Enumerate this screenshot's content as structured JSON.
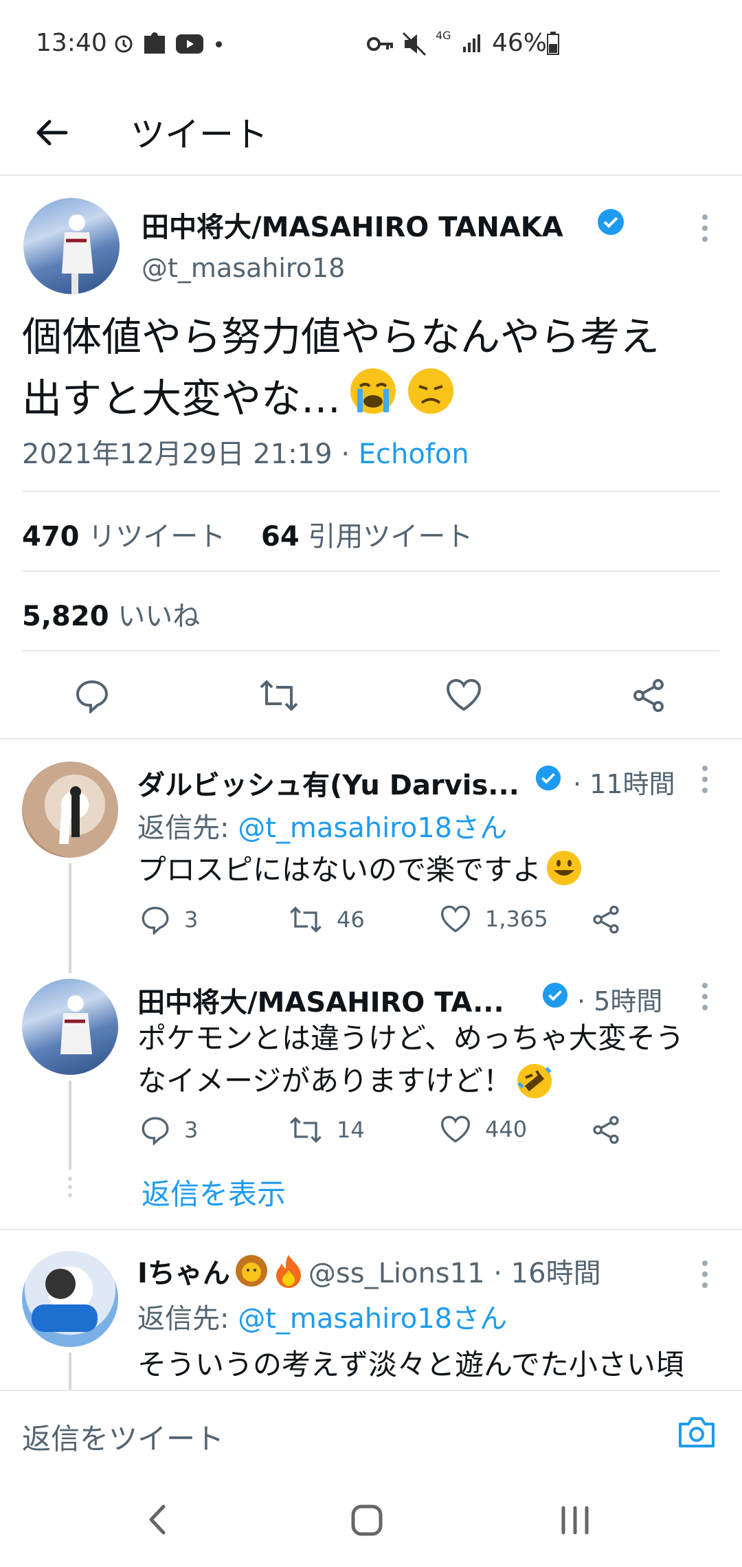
{
  "status_bar": {
    "time": "13:40",
    "battery": "46%",
    "network": "4G"
  },
  "header": {
    "title": "ツイート"
  },
  "main_tweet": {
    "display_name": "田中将大/MASAHIRO TANAKA",
    "handle": "@t_masahiro18",
    "text_line1": "個体値やら努力値やらなんやら考え",
    "text_line2": "出すと大変やな…",
    "timestamp": "2021年12月29日 21:19",
    "separator": "·",
    "client": "Echofon",
    "retweets": "470",
    "retweets_label": "リツイート",
    "quotes": "64",
    "quotes_label": "引用ツイート",
    "likes": "5,820",
    "likes_label": "いいね"
  },
  "replies": [
    {
      "display_name": "ダルビッシュ有(Yu Darvis...",
      "time": "· 11時間",
      "reply_to_label": "返信先:",
      "reply_to": "@t_masahiro18さん",
      "text": "プロスピにはないので楽ですよ",
      "reply_count": "3",
      "retweet_count": "46",
      "like_count": "1,365"
    },
    {
      "display_name": "田中将大/MASAHIRO TA...",
      "time": "· 5時間",
      "text_line1": "ポケモンとは違うけど、めっちゃ大変そう",
      "text_line2": "なイメージがありますけど！",
      "reply_count": "3",
      "retweet_count": "14",
      "like_count": "440",
      "show_replies": "返信を表示"
    },
    {
      "display_name": "Iちゃん",
      "handle_time": "@ss_Lions11 · 16時間",
      "reply_to_label": "返信先:",
      "reply_to": "@t_masahiro18さん",
      "text": "そういうの考えず淡々と遊んでた小さい頃"
    }
  ],
  "composer": {
    "placeholder": "返信をツイート"
  },
  "colors": {
    "accent": "#1d9bf0",
    "text": "#0f1419",
    "muted": "#536471",
    "divider": "#e7e9ea"
  }
}
